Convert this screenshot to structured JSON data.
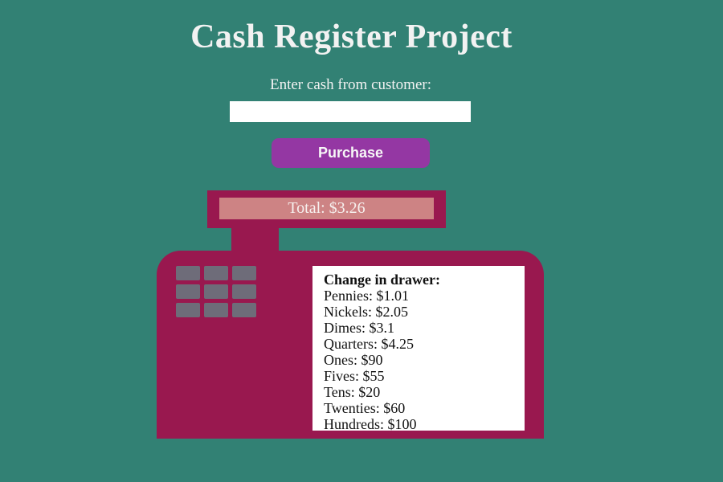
{
  "page": {
    "title": "Cash Register Project"
  },
  "form": {
    "cash_label": "Enter cash from customer:",
    "cash_value": "",
    "purchase_label": "Purchase"
  },
  "register": {
    "total_text": "Total: $3.26",
    "drawer": {
      "title": "Change in drawer:",
      "lines": [
        "Pennies: $1.01",
        "Nickels: $2.05",
        "Dimes: $3.1",
        "Quarters: $4.25",
        "Ones: $90",
        "Fives: $55",
        "Tens: $20",
        "Twenties: $60",
        "Hundreds: $100"
      ]
    }
  },
  "colors": {
    "background": "#328174",
    "register": "#99184f",
    "total_display": "#cd8384",
    "button": "#9437a3",
    "keypad_key": "#6e6c79"
  },
  "icons": {
    "register_keypad": "keypad-icon"
  }
}
